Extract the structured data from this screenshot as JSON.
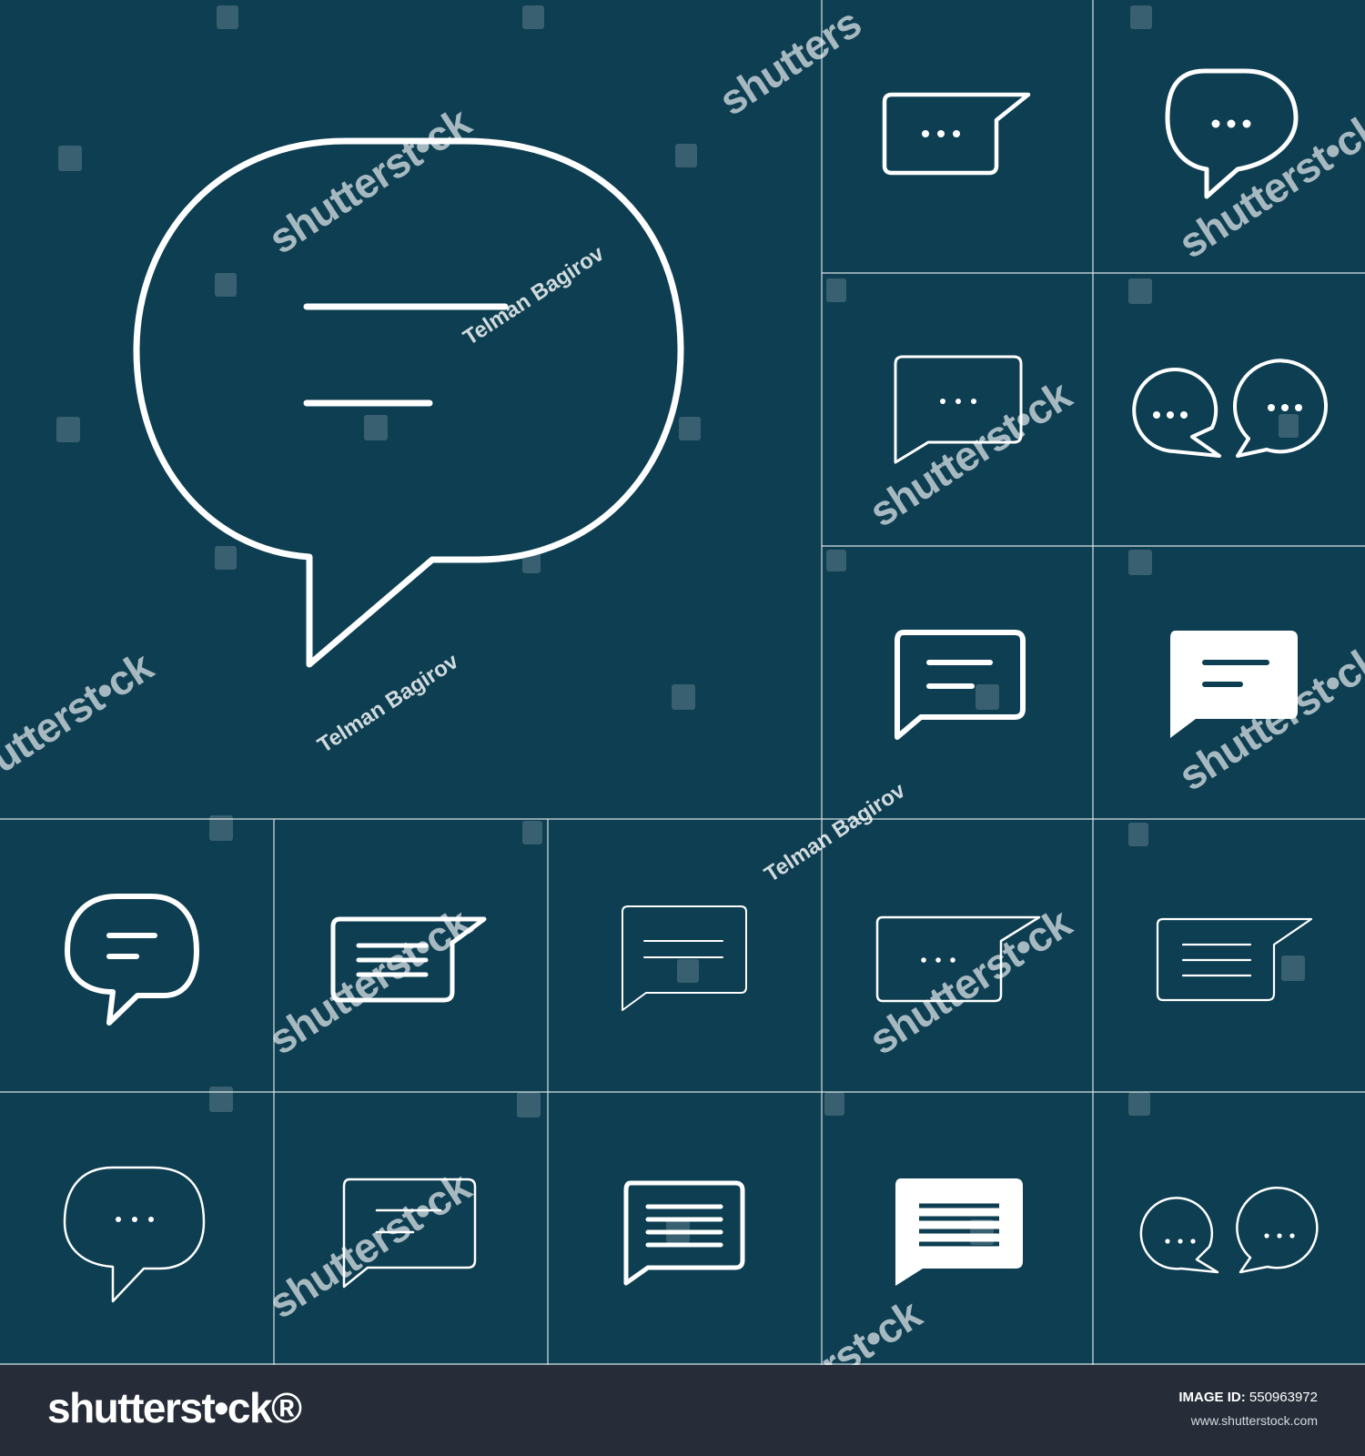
{
  "colors": {
    "background": "#0d3e51",
    "grid_line": "#d9e2e6",
    "icon_stroke": "#ffffff",
    "footer_background": "#262d38"
  },
  "icons": [
    "speech-bubble-lines-large-icon",
    "rectangle-bubble-dots-icon",
    "oval-bubble-dots-icon",
    "rectangle-bubble-dots-thin-icon",
    "two-round-bubbles-dots-icon",
    "rectangle-bubble-lines-icon",
    "rectangle-bubble-lines-filled-icon",
    "round-bubble-lines-icon",
    "rectangle-bubble-three-lines-icon",
    "rectangle-bubble-two-lines-thin-icon",
    "rectangle-bubble-dots-thin-icon",
    "rectangle-bubble-three-lines-thin-icon",
    "oval-bubble-dots-thin-icon",
    "rectangle-bubble-lines-thin-icon",
    "rectangle-bubble-four-lines-icon",
    "rectangle-bubble-four-lines-filled-icon",
    "two-round-bubbles-dots-thin-icon"
  ],
  "watermarks": {
    "brand": "shutterst•ck",
    "brand_partial_top": "shutters",
    "brand_partial_bottom": "rst•ck",
    "brand_partial_left": "utterst•ck",
    "author": "Telman Bagirov"
  },
  "footer": {
    "logo": "shutterst•ck®",
    "image_id_label": "IMAGE ID:",
    "image_id": "550963972",
    "url": "www.shutterstock.com"
  }
}
